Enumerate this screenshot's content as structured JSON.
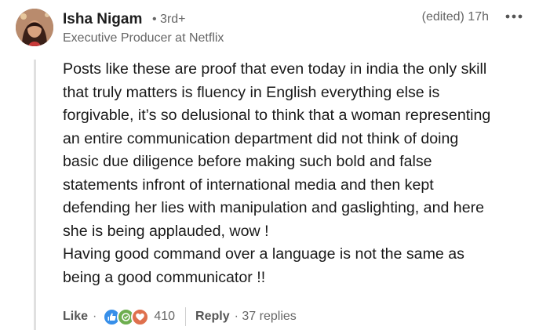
{
  "author": {
    "name": "Isha Nigam",
    "degree": "• 3rd+",
    "headline": "Executive Producer at Netflix"
  },
  "meta": {
    "edited_time": "(edited) 17h"
  },
  "comment": {
    "lines": [
      "Posts like these are proof that even today in india the only skill",
      "that truly matters is fluency in English everything else is",
      "forgivable, it’s so delusional to think that a woman representing",
      "an entire communication department did not think of doing",
      "basic due diligence before making such bold and false",
      "statements infront of international media and then kept",
      "defending her lies with manipulation and gaslighting, and here",
      "she is being applauded, wow !",
      "Having good command over a language is not the same as",
      "being a good communicator !!"
    ]
  },
  "actions": {
    "like_label": "Like",
    "dot": "·",
    "reaction_count": "410",
    "reply_label": "Reply",
    "replies_count": "· 37 replies",
    "reaction_icons": [
      "like-icon",
      "celebrate-icon",
      "love-icon"
    ]
  },
  "colors": {
    "like": "#378fe9",
    "celebrate": "#44712e",
    "love": "#df704d"
  }
}
